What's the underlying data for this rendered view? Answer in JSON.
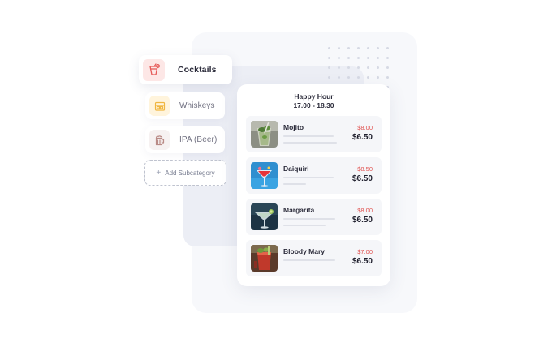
{
  "categories": {
    "items": [
      {
        "label": "Cocktails",
        "icon": "cocktail-icon",
        "active": true
      },
      {
        "label": "Whiskeys",
        "icon": "whiskey-icon",
        "active": false
      },
      {
        "label": "IPA (Beer)",
        "icon": "beer-mug-icon",
        "active": false
      }
    ],
    "add_label": "Add Subcategory"
  },
  "menu": {
    "title_line1": "Happy Hour",
    "title_line2": "17.00 - 18.30",
    "items": [
      {
        "name": "Mojito",
        "old_price": "$8.00",
        "price": "$6.50",
        "image": "mojito-image"
      },
      {
        "name": "Daiquiri",
        "old_price": "$8.50",
        "price": "$6.50",
        "image": "daiquiri-image"
      },
      {
        "name": "Margarita",
        "old_price": "$8.00",
        "price": "$6.50",
        "image": "margarita-image"
      },
      {
        "name": "Bloody Mary",
        "old_price": "$7.00",
        "price": "$6.50",
        "image": "bloody-mary-image"
      }
    ]
  },
  "colors": {
    "accent_red": "#e0514f",
    "cocktail_bg": "#fde7e6",
    "whiskey_bg": "#fff4dc"
  }
}
